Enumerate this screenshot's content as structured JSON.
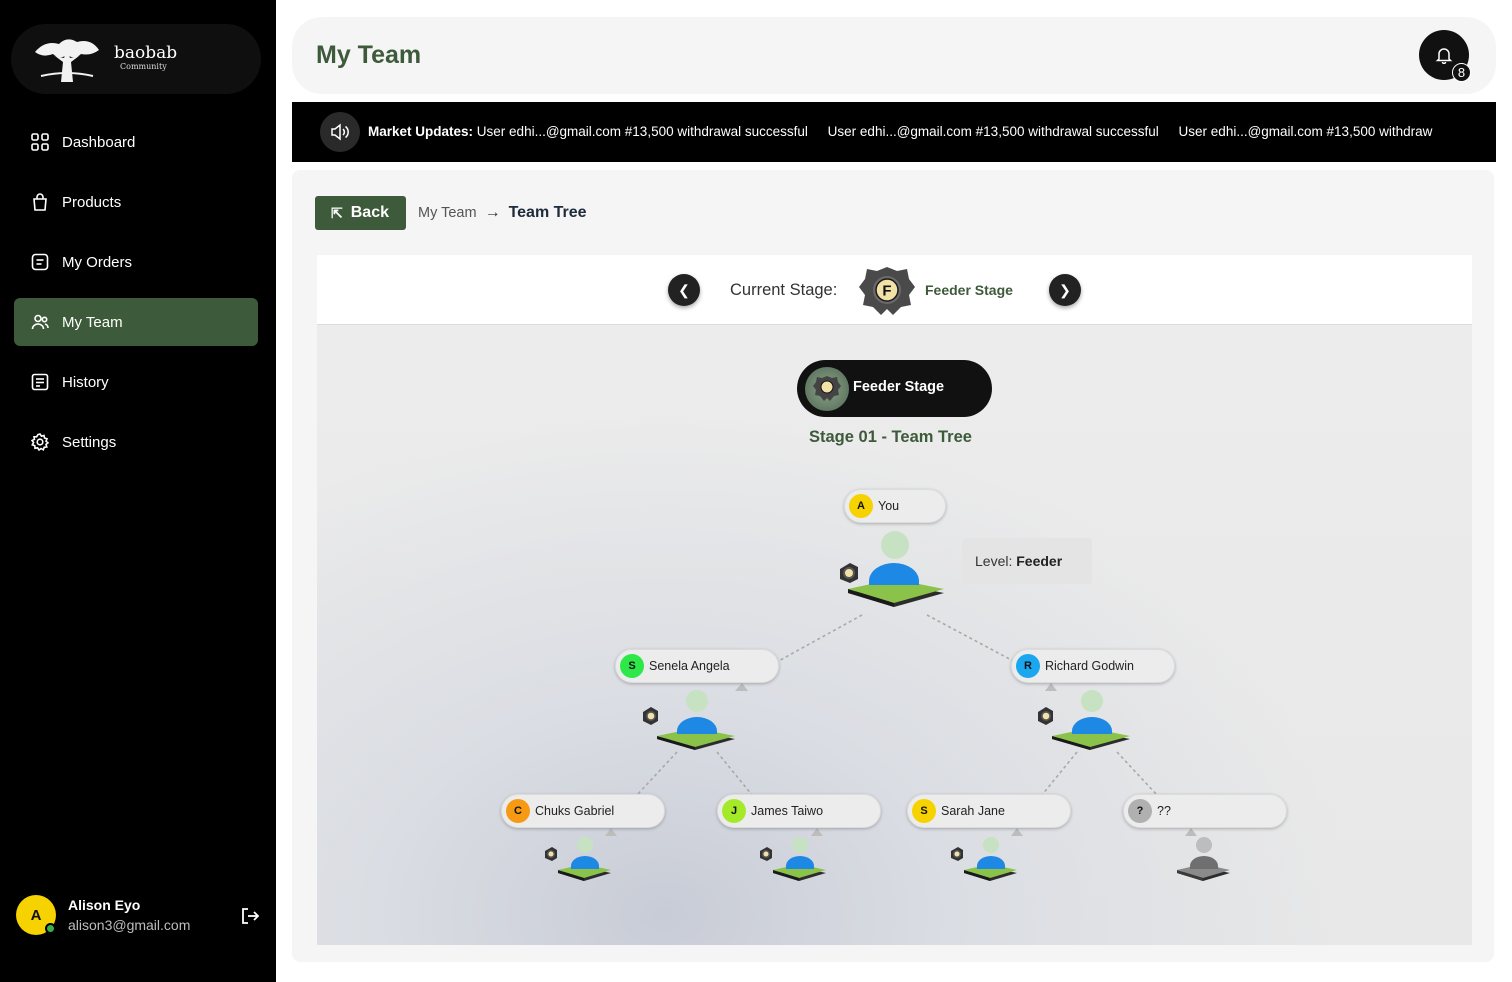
{
  "brand": {
    "name": "baobab",
    "subtitle": "Community"
  },
  "sidebar": {
    "items": [
      {
        "label": "Dashboard",
        "icon": "grid-icon",
        "active": false
      },
      {
        "label": "Products",
        "icon": "bag-icon",
        "active": false
      },
      {
        "label": "My Orders",
        "icon": "orders-icon",
        "active": false
      },
      {
        "label": "My Team",
        "icon": "team-icon",
        "active": true
      },
      {
        "label": "History",
        "icon": "history-icon",
        "active": false
      },
      {
        "label": "Settings",
        "icon": "gear-icon",
        "active": false
      }
    ]
  },
  "user": {
    "initial": "A",
    "name": "Alison Eyo",
    "email": "alison3@gmail.com",
    "status": "online"
  },
  "header": {
    "title": "My Team",
    "notification_count": "8"
  },
  "ticker": {
    "label": "Market Updates:",
    "messages": [
      "User edhi...@gmail.com #13,500 withdrawal successful",
      "User edhi...@gmail.com #13,500 withdrawal successful",
      "User edhi...@gmail.com #13,500 withdraw"
    ]
  },
  "breadcrumb": {
    "back": "Back",
    "parent": "My Team",
    "current": "Team Tree"
  },
  "stage": {
    "current_label": "Current Stage:",
    "badge_letter": "F",
    "name": "Feeder Stage"
  },
  "tree": {
    "pill": "Feeder Stage",
    "subtitle": "Stage 01 - Team Tree",
    "level_label": "Level:",
    "level_value": "Feeder",
    "nodes": [
      {
        "name": "You",
        "initial": "A",
        "color": "#f5d200"
      },
      {
        "name": "Senela Angela",
        "initial": "S",
        "color": "#2ee84a"
      },
      {
        "name": "Richard Godwin",
        "initial": "R",
        "color": "#1ba7ef"
      },
      {
        "name": "Chuks Gabriel",
        "initial": "C",
        "color": "#f59a12"
      },
      {
        "name": "James Taiwo",
        "initial": "J",
        "color": "#a4ea2a"
      },
      {
        "name": "Sarah Jane",
        "initial": "S",
        "color": "#f5d200"
      },
      {
        "name": "??",
        "initial": "?",
        "color": "#b0b0b0"
      }
    ]
  },
  "colors": {
    "brand_green": "#3d5a3a",
    "sidebar_bg": "#000000",
    "ticker_bg": "#000000"
  }
}
